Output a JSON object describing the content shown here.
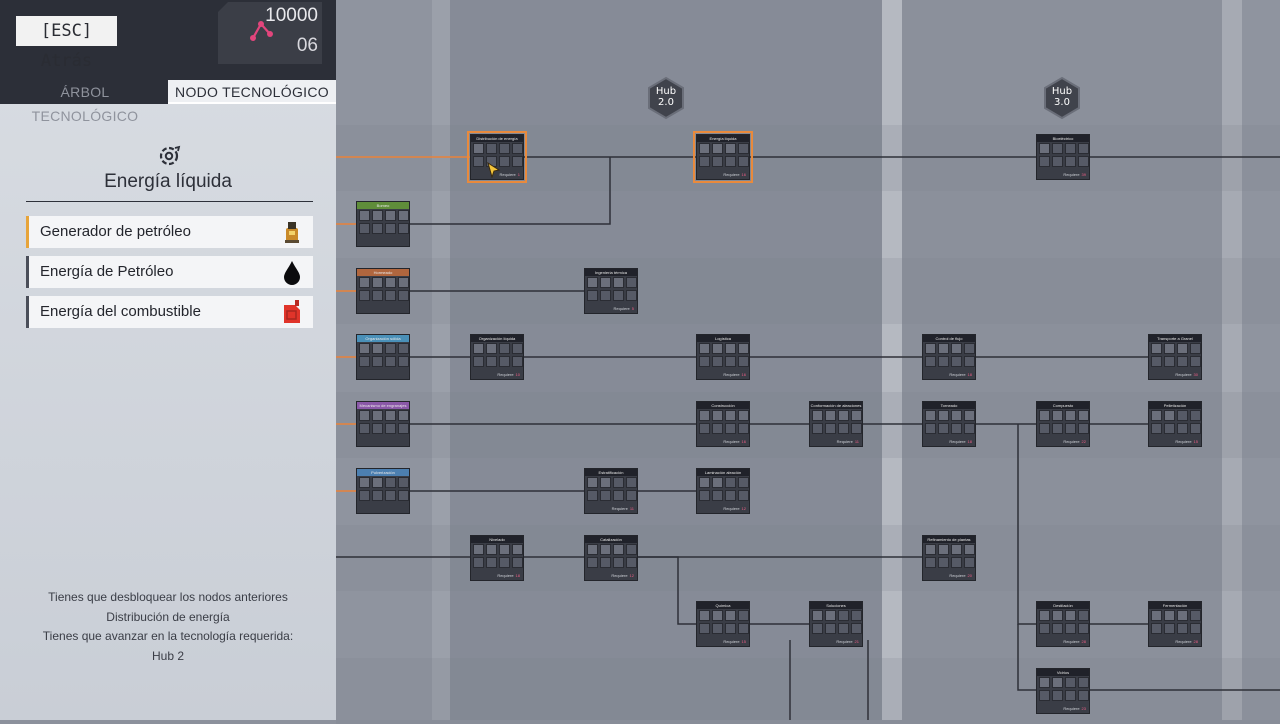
{
  "header": {
    "back_label": "[ESC] Atrás",
    "points_total": "10000",
    "points_level": "06"
  },
  "tabs": [
    {
      "label": "ÁRBOL TECNOLÓGICO"
    },
    {
      "label": "NODO TECNOLÓGICO"
    }
  ],
  "node_detail": {
    "title": "Energía líquida",
    "unlocks": [
      {
        "label": "Generador de petróleo",
        "icon": "oil-generator-icon"
      },
      {
        "label": "Energía de Petróleo",
        "icon": "oil-drop-icon"
      },
      {
        "label": "Energía del combustible",
        "icon": "fuel-can-icon"
      }
    ],
    "requirements": [
      "Tienes que desbloquear los nodos anteriores",
      "Distribución de energía",
      "Tienes que avanzar en la tecnología requerida:",
      "Hub 2"
    ]
  },
  "hubs": [
    {
      "line1": "Hub",
      "line2": "2.0"
    },
    {
      "line1": "Hub",
      "line2": "3.0"
    }
  ],
  "requires_label": "Requiere",
  "nodes": [
    {
      "title": "Distribución de energía",
      "req": "1",
      "active": true
    },
    {
      "title": "Energía líquida",
      "req": "16",
      "active": true
    },
    {
      "title": "Bioeléctrico",
      "req": "39"
    },
    {
      "title": "Bomeo",
      "req": ""
    },
    {
      "title": "Hormeado",
      "req": ""
    },
    {
      "title": "Ingeniería térmica",
      "req": "5"
    },
    {
      "title": "Organización sólida",
      "req": ""
    },
    {
      "title": "Organización líquida",
      "req": "10"
    },
    {
      "title": "Logística",
      "req": "16"
    },
    {
      "title": "Control de flujo",
      "req": "18"
    },
    {
      "title": "Transporte a Granel",
      "req": "30"
    },
    {
      "title": "Mecanismo de engranajes",
      "req": ""
    },
    {
      "title": "Construcción",
      "req": "16"
    },
    {
      "title": "Conformación de aleaciones",
      "req": "11"
    },
    {
      "title": "Torneado",
      "req": "18"
    },
    {
      "title": "Compuesto",
      "req": "22"
    },
    {
      "title": "Pelletización",
      "req": "15"
    },
    {
      "title": "Pulverización",
      "req": ""
    },
    {
      "title": "Estratificación",
      "req": "11"
    },
    {
      "title": "Laminación aleación",
      "req": "12"
    },
    {
      "title": "Nivelado",
      "req": "18"
    },
    {
      "title": "Catalización",
      "req": "12"
    },
    {
      "title": "Refinamiento de plantas",
      "req": "20"
    },
    {
      "title": "Química",
      "req": "15"
    },
    {
      "title": "Soluciones",
      "req": "21"
    },
    {
      "title": "Destilación",
      "req": "28"
    },
    {
      "title": "Fermentación",
      "req": "28"
    },
    {
      "title": "Vidrios",
      "req": "23"
    }
  ],
  "colors": {
    "accent_orange": "#e98a3c",
    "points_pink": "#e2457c",
    "panel_dark": "#2c2f38"
  }
}
